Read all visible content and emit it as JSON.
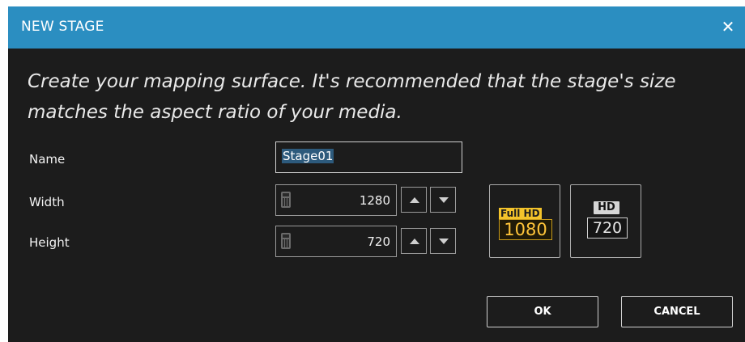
{
  "window": {
    "title": "NEW STAGE",
    "close_glyph": "✕"
  },
  "intro": "Create your mapping surface. It's recommended that the stage's size matches the aspect ratio of your media.",
  "form": {
    "name_label": "Name",
    "name_value": "Stage01",
    "width_label": "Width",
    "width_value": "1280",
    "height_label": "Height",
    "height_value": "720"
  },
  "presets": {
    "full_hd": {
      "top": "Full HD",
      "number": "1080"
    },
    "hd": {
      "top": "HD",
      "number": "720"
    }
  },
  "buttons": {
    "ok": "OK",
    "cancel": "CANCEL"
  },
  "colors": {
    "titlebar": "#2b8ec1",
    "background": "#1c1c1c",
    "selection": "#2d5a7c",
    "gold": "#f3c32b"
  },
  "icons": [
    "close-icon",
    "calculator-icon",
    "up-arrow-icon",
    "down-arrow-icon"
  ]
}
